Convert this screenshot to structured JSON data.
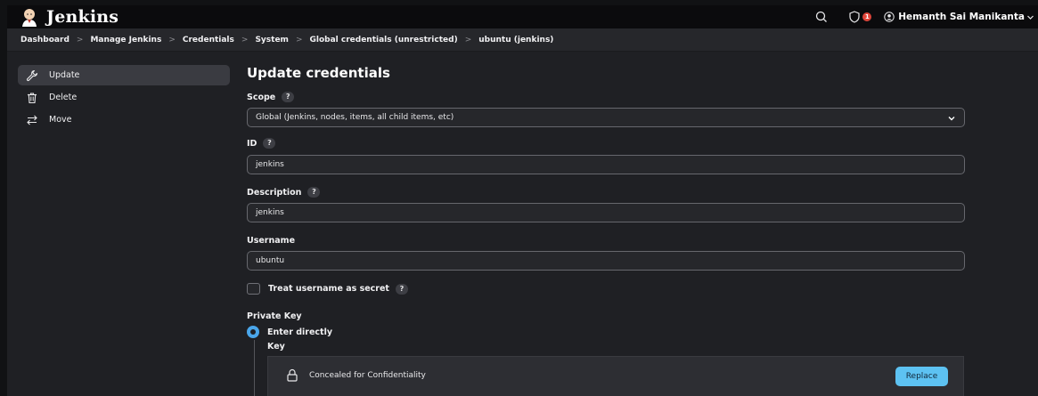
{
  "header": {
    "app_name": "Jenkins",
    "notification_count": "1",
    "user_name": "Hemanth Sai Manikanta"
  },
  "breadcrumb": [
    "Dashboard",
    "Manage Jenkins",
    "Credentials",
    "System",
    "Global credentials (unrestricted)",
    "ubuntu (jenkins)"
  ],
  "sidebar": {
    "items": [
      {
        "label": "Update",
        "icon": "wrench-icon",
        "active": true
      },
      {
        "label": "Delete",
        "icon": "trash-icon",
        "active": false
      },
      {
        "label": "Move",
        "icon": "move-arrows-icon",
        "active": false
      }
    ]
  },
  "form": {
    "title": "Update credentials",
    "help_glyph": "?",
    "scope": {
      "label": "Scope",
      "value": "Global (Jenkins, nodes, items, all child items, etc)"
    },
    "id": {
      "label": "ID",
      "value": "jenkins"
    },
    "description": {
      "label": "Description",
      "value": "jenkins"
    },
    "username": {
      "label": "Username",
      "value": "ubuntu"
    },
    "treat_secret": {
      "label": "Treat username as secret",
      "checked": false
    },
    "private_key": {
      "label": "Private Key",
      "option": "Enter directly",
      "key_label": "Key",
      "concealed_text": "Concealed for Confidentiality",
      "replace_label": "Replace"
    }
  },
  "colors": {
    "background": "#1f2024",
    "header": "#0b0b0d",
    "accent": "#5dc2f2",
    "badge": "#e0453a"
  }
}
